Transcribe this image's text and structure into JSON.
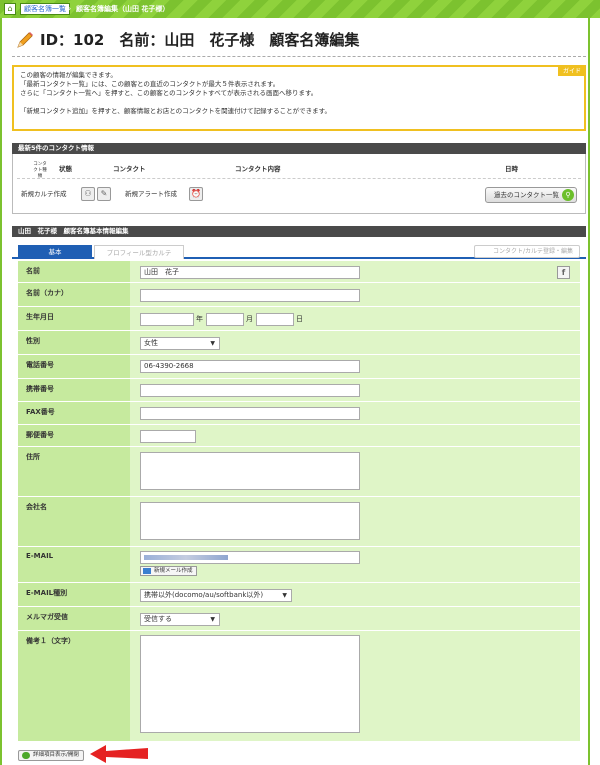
{
  "breadcrumb": {
    "home_icon": "home-icon",
    "link": "顧客名簿一覧",
    "separator": "›",
    "current": "顧客名簿編集（山田 花子様）"
  },
  "title": "ID：102　名前：山田　花子様　顧客名簿編集",
  "guide": {
    "tag": "ガイド",
    "lines": [
      "この顧客の情報が編集できます。",
      "「最新コンタクト一覧」には、この顧客との直近のコンタクトが最大５件表示されます。",
      "さらに「コンタクト一覧へ」を押すと、この顧客とのコンタクトすべてが表示される画面へ移ります。",
      "",
      "「新規コンタクト追加」を押すと、顧客情報とお店とのコンタクトを関連付けて記録することができます。"
    ]
  },
  "contacts": {
    "header": "最新5件のコンタクト情報",
    "col_type": "コンタクト種類",
    "col_status": "状態",
    "col_contact": "コンタクト",
    "col_content": "コンタクト内容",
    "col_date": "日時",
    "new_chart": "新規カルテ作成",
    "new_alert": "新規アラート作成",
    "past_button": "過去のコンタクト一覧"
  },
  "basic": {
    "header": "山田　花子様　顧客名簿基本情報編集",
    "tab_basic": "基本",
    "tab_profile": "プロフィール型カルテ",
    "register_button": "コンタクト/カルテ登録・編集"
  },
  "form": {
    "name_label": "名前",
    "name_value": "山田　花子",
    "kana_label": "名前（カナ）",
    "kana_value": "",
    "birth_label": "生年月日",
    "year_unit": "年",
    "month_unit": "月",
    "day_unit": "日",
    "gender_label": "性別",
    "gender_value": "女性",
    "phone_label": "電話番号",
    "phone_value": "06-4390-2668",
    "mobile_label": "携帯番号",
    "mobile_value": "",
    "fax_label": "FAX番号",
    "fax_value": "",
    "zip_label": "郵便番号",
    "zip_value": "",
    "address_label": "住所",
    "company_label": "会社名",
    "email_label": "E-MAIL",
    "new_mail_button": "新規メール作成",
    "email_type_label": "E-MAIL種別",
    "email_type_value": "携帯以外(docomo/au/softbank以外)",
    "magazine_label": "メルマガ受信",
    "magazine_value": "受信する",
    "note_label": "備考１（文字）"
  },
  "toggle_button": "詳細項目表示/開閉"
}
